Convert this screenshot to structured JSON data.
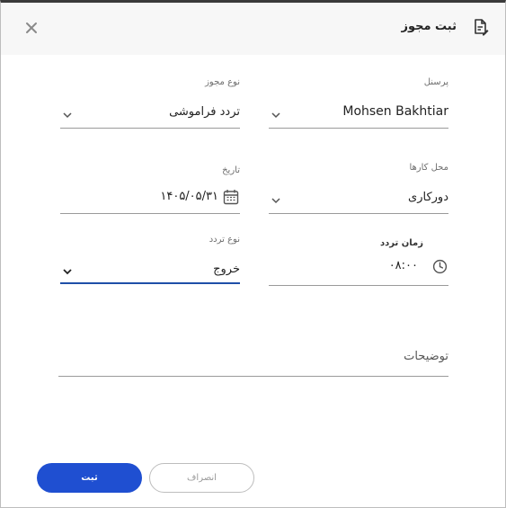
{
  "dialog": {
    "title": "ثبت مجوز",
    "title_icon": "document-edit-icon",
    "close_icon": "close-icon"
  },
  "form": {
    "personnel": {
      "label": "پرسنل",
      "value": "Mohsen Bakhtiar"
    },
    "permit_type": {
      "label": "نوع مجوز",
      "value": "تردد فراموشی"
    },
    "work_location": {
      "label": "محل کارها",
      "value": "دورکاری"
    },
    "date": {
      "label": "تاریخ",
      "value": "۱۴۰۵/۰۵/۳۱"
    },
    "traffic_time": {
      "label": "زمان تردد",
      "value": "۰۸:۰۰"
    },
    "traffic_type": {
      "label": "نوع تردد",
      "value": "خروج"
    },
    "description": {
      "placeholder": "توضیحات"
    }
  },
  "buttons": {
    "submit": "ثبت",
    "cancel": "انصراف"
  },
  "colors": {
    "primary": "#1f4fd1",
    "active_underline": "#1f4fa8"
  }
}
